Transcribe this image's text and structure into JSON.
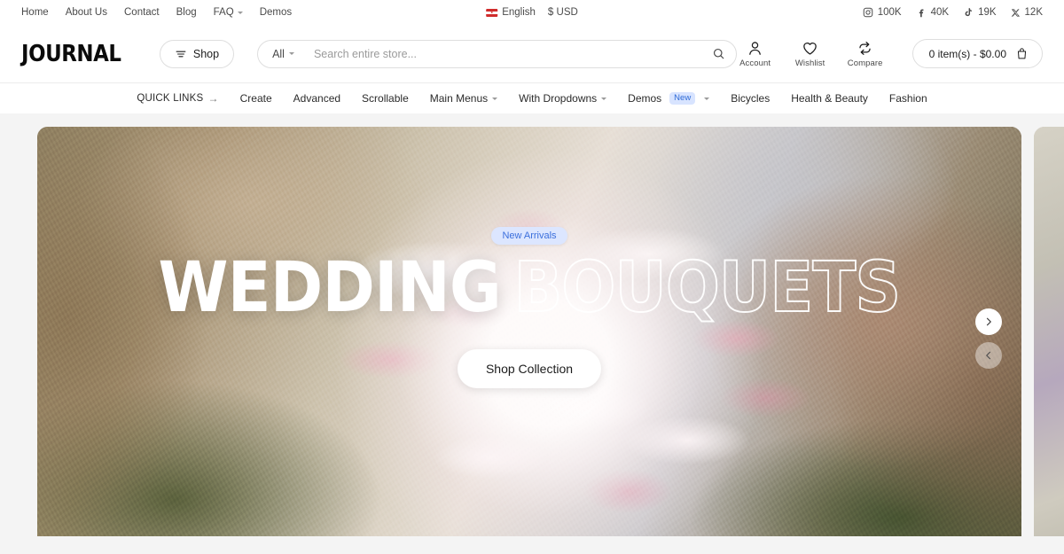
{
  "topbar": {
    "links": [
      {
        "label": "Home",
        "caret": false
      },
      {
        "label": "About Us",
        "caret": false
      },
      {
        "label": "Contact",
        "caret": false
      },
      {
        "label": "Blog",
        "caret": false
      },
      {
        "label": "FAQ",
        "caret": true
      },
      {
        "label": "Demos",
        "caret": false
      }
    ],
    "language": "English",
    "currency": "$ USD",
    "socials": [
      {
        "icon": "instagram-icon",
        "count": "100K"
      },
      {
        "icon": "facebook-icon",
        "count": "40K"
      },
      {
        "icon": "tiktok-icon",
        "count": "19K"
      },
      {
        "icon": "x-twitter-icon",
        "count": "12K"
      }
    ]
  },
  "header": {
    "logo": "JOURNAL",
    "shop_label": "Shop",
    "search": {
      "category": "All",
      "placeholder": "Search entire store...",
      "value": ""
    },
    "actions": [
      {
        "icon": "user-icon",
        "label": "Account"
      },
      {
        "icon": "heart-icon",
        "label": "Wishlist"
      },
      {
        "icon": "compare-icon",
        "label": "Compare"
      }
    ],
    "cart_label": "0 item(s) - $0.00"
  },
  "nav": {
    "items": [
      {
        "label": "QUICK LINKS",
        "arrow": "→",
        "caret": false,
        "badge": ""
      },
      {
        "label": "Create",
        "arrow": "",
        "caret": false,
        "badge": ""
      },
      {
        "label": "Advanced",
        "arrow": "",
        "caret": false,
        "badge": ""
      },
      {
        "label": "Scrollable",
        "arrow": "",
        "caret": false,
        "badge": ""
      },
      {
        "label": "Main Menus",
        "arrow": "",
        "caret": true,
        "badge": ""
      },
      {
        "label": "With Dropdowns",
        "arrow": "",
        "caret": true,
        "badge": ""
      },
      {
        "label": "Demos",
        "arrow": "",
        "caret": true,
        "badge": "New"
      },
      {
        "label": "Bicycles",
        "arrow": "",
        "caret": false,
        "badge": ""
      },
      {
        "label": "Health & Beauty",
        "arrow": "",
        "caret": false,
        "badge": ""
      },
      {
        "label": "Fashion",
        "arrow": "",
        "caret": false,
        "badge": ""
      }
    ]
  },
  "hero": {
    "badge": "New Arrivals",
    "title_solid": "WEDDING",
    "title_outline": "BOUQUETS",
    "cta": "Shop Collection",
    "next_label": "next-slide",
    "prev_label": "previous-slide"
  },
  "colors": {
    "page_bg": "#f4f4f4",
    "surface": "#ffffff",
    "text": "#1c1c1c",
    "muted": "#4a4a4a",
    "badge_bg": "#d8e4ff",
    "badge_fg": "#2f6bd6",
    "border": "#dedede"
  }
}
